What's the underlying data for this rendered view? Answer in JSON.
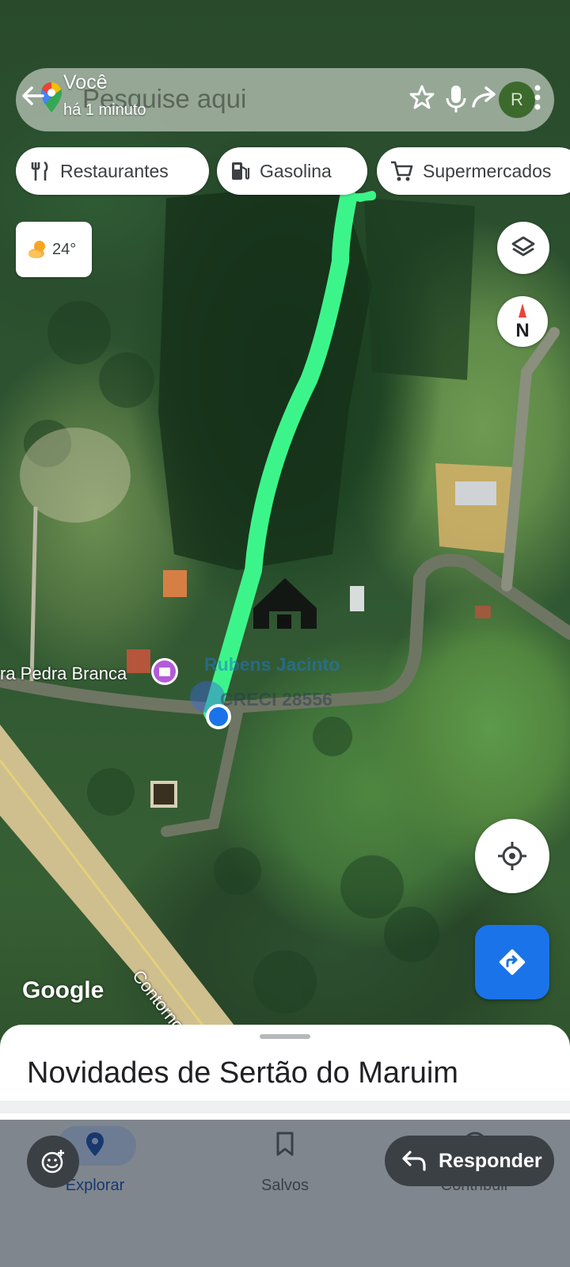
{
  "search": {
    "placeholder": "Pesquise aqui",
    "profile_name": "Você",
    "profile_time": "há 1 minuto",
    "avatar_initial": "R"
  },
  "chips": [
    {
      "label": "Restaurantes",
      "icon": "fork-knife-icon"
    },
    {
      "label": "Gasolina",
      "icon": "gas-pump-icon"
    },
    {
      "label": "Supermercados",
      "icon": "shopping-cart-icon"
    }
  ],
  "weather": {
    "temperature": "24°",
    "icon": "partly-sunny-icon"
  },
  "map": {
    "place_label": "ra Pedra Branca",
    "road_label": "Contorno da",
    "google_logo": "Google",
    "compass_letter": "N",
    "watermark_name": "Rubens Jacinto",
    "watermark_creci": "CRECI 28556",
    "route_color": "#3cf58a",
    "location_dot_color": "#1a73e8"
  },
  "sheet": {
    "title": "Novidades de Sertão do Maruim"
  },
  "nav": {
    "explore": "Explorar",
    "saved": "Salvos",
    "contribute": "Contribuir"
  },
  "reply": {
    "label": "Responder"
  }
}
